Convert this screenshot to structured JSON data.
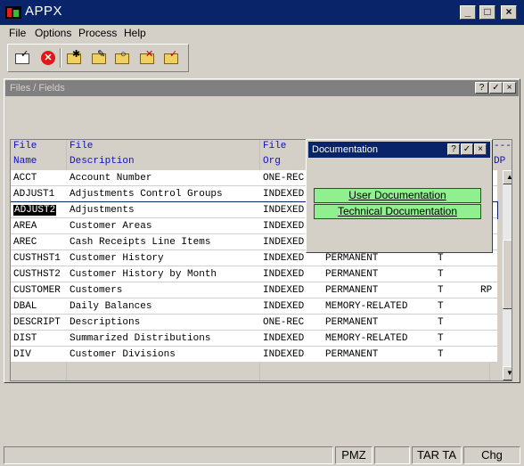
{
  "window": {
    "title": "APPX",
    "minimize_label": "_",
    "maximize_label": "□",
    "close_label": "×"
  },
  "menu": [
    {
      "label": "File"
    },
    {
      "label": "Options"
    },
    {
      "label": "Process"
    },
    {
      "label": "Help"
    }
  ],
  "toolbar": {
    "icons": [
      "checkmark-icon",
      "cancel-icon",
      "new-folder-icon",
      "edit-folder-icon",
      "search-folder-icon",
      "delete-folder-icon",
      "check-folder-icon"
    ]
  },
  "subwindow": {
    "title": "Files / Fields",
    "help_label": "?",
    "check_label": "✓",
    "close_label": "×"
  },
  "table": {
    "headers": [
      {
        "line1": "File",
        "line2": "Name"
      },
      {
        "line1": "File",
        "line2": "Description"
      },
      {
        "line1": "File",
        "line2": "Org"
      },
      {
        "line1": "---",
        "line2": "DP"
      }
    ],
    "rows": [
      {
        "name": "ACCT",
        "desc": "Account Number",
        "org": "ONE-REC",
        "type": "",
        "flag": "",
        "extra": ""
      },
      {
        "name": "ADJUST1",
        "desc": "Adjustments Control Groups",
        "org": "INDEXED",
        "type": "",
        "flag": "",
        "extra": ""
      },
      {
        "name": "ADJUST2",
        "desc": "Adjustments",
        "org": "INDEXED",
        "type": "",
        "flag": "",
        "extra": ""
      },
      {
        "name": "AREA",
        "desc": "Customer Areas",
        "org": "INDEXED",
        "type": "",
        "flag": "",
        "extra": ""
      },
      {
        "name": "AREC",
        "desc": "Cash Receipts Line Items",
        "org": "INDEXED",
        "type": "",
        "flag": "",
        "extra": ""
      },
      {
        "name": "CUSTHST1",
        "desc": "Customer History",
        "org": "INDEXED",
        "type": "PERMANENT",
        "flag": "T",
        "extra": ""
      },
      {
        "name": "CUSTHST2",
        "desc": "Customer History by Month",
        "org": "INDEXED",
        "type": "PERMANENT",
        "flag": "T",
        "extra": ""
      },
      {
        "name": "CUSTOMER",
        "desc": "Customers",
        "org": "INDEXED",
        "type": "PERMANENT",
        "flag": "T",
        "extra": "RP"
      },
      {
        "name": "DBAL",
        "desc": "Daily Balances",
        "org": "INDEXED",
        "type": "MEMORY-RELATED",
        "flag": "T",
        "extra": ""
      },
      {
        "name": "DESCRIPT",
        "desc": "Descriptions",
        "org": "ONE-REC",
        "type": "PERMANENT",
        "flag": "T",
        "extra": ""
      },
      {
        "name": "DIST",
        "desc": "Summarized Distributions",
        "org": "INDEXED",
        "type": "MEMORY-RELATED",
        "flag": "T",
        "extra": ""
      },
      {
        "name": "DIV",
        "desc": "Customer Divisions",
        "org": "INDEXED",
        "type": "PERMANENT",
        "flag": "T",
        "extra": ""
      }
    ]
  },
  "dialog": {
    "title": "Documentation",
    "help_label": "?",
    "check_label": "✓",
    "close_label": "×",
    "user_doc_label": "User Documentation",
    "tech_doc_label": "Technical Documentation"
  },
  "status": {
    "panels": [
      "",
      "PMZ",
      "",
      "TAR TA",
      "Chg"
    ]
  }
}
